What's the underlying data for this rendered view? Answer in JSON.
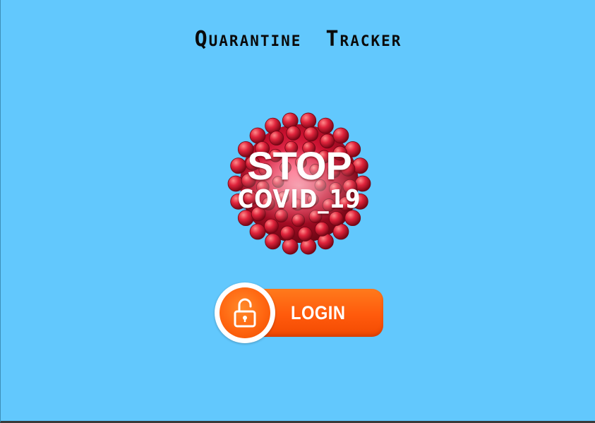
{
  "app": {
    "title": "Quarantine Tracker"
  },
  "badge": {
    "line1": "STOP",
    "line2": "COVID_19"
  },
  "login": {
    "label": "LOGIN",
    "icon": "unlocked-padlock-icon"
  },
  "colors": {
    "background": "#62c8fd",
    "button_orange": "#ff5a0c",
    "virus_red": "#d5203a"
  }
}
